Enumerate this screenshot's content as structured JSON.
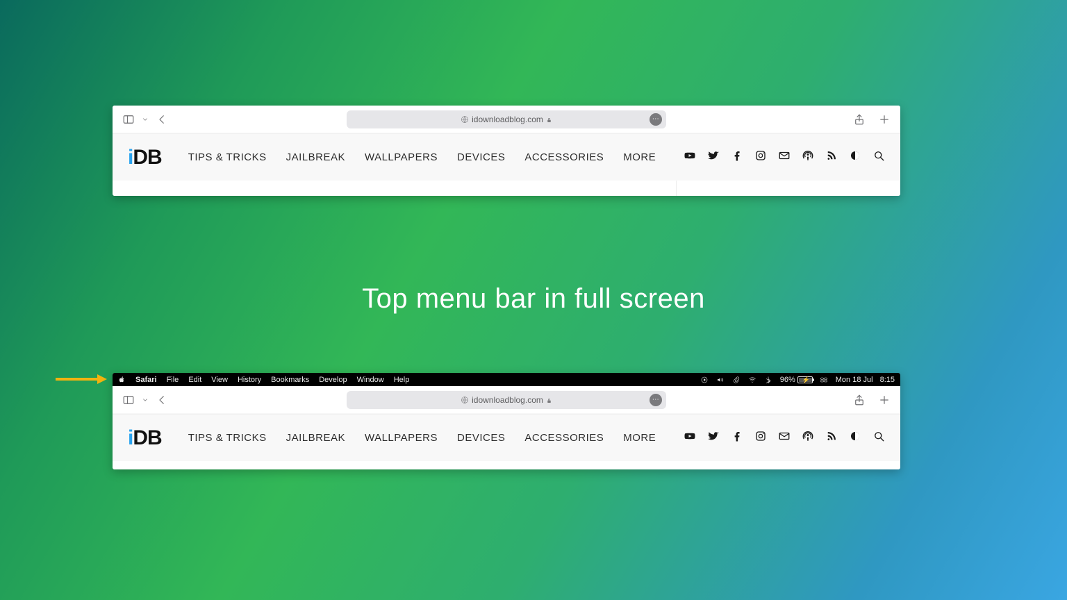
{
  "caption": "Top menu bar in full screen",
  "address_url": "idownloadblog.com",
  "logo": {
    "i": "i",
    "db": "DB"
  },
  "nav": [
    "TIPS & TRICKS",
    "JAILBREAK",
    "WALLPAPERS",
    "DEVICES",
    "ACCESSORIES",
    "MORE"
  ],
  "menubar": {
    "app": "Safari",
    "items": [
      "File",
      "Edit",
      "View",
      "History",
      "Bookmarks",
      "Develop",
      "Window",
      "Help"
    ],
    "battery": "96%",
    "date": "Mon 18 Jul",
    "time": "8:15"
  }
}
